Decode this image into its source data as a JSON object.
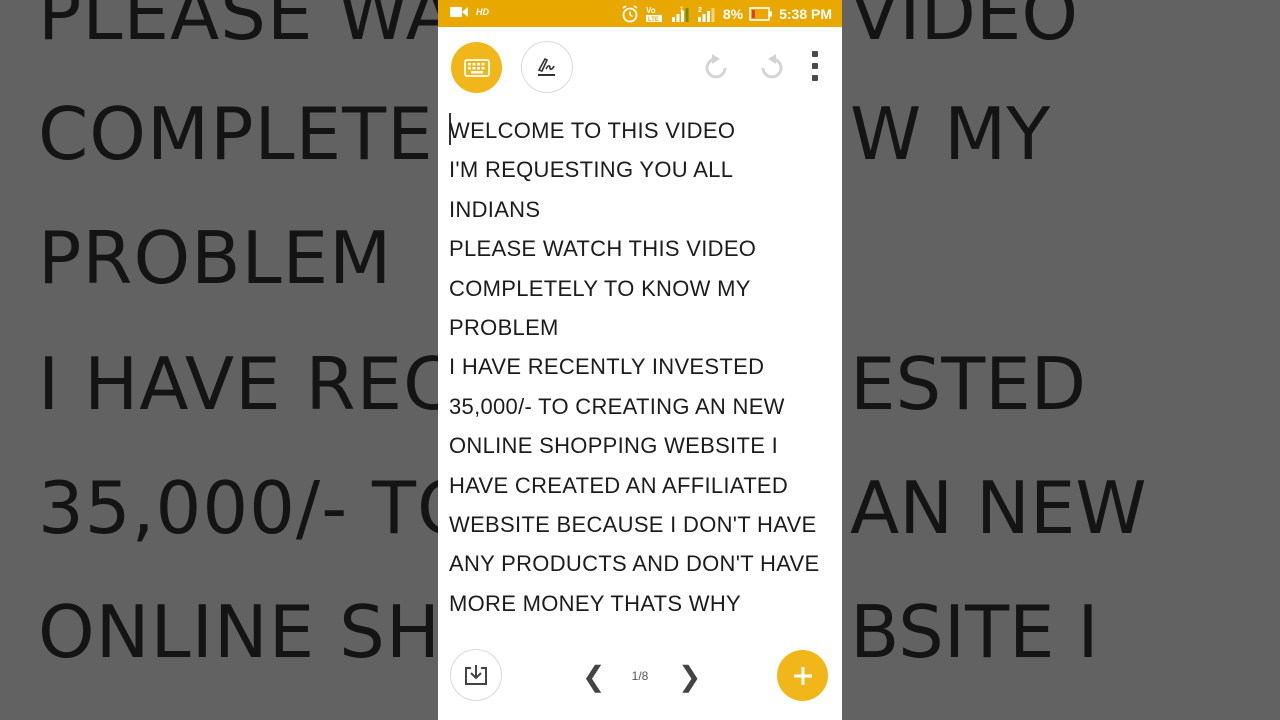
{
  "background": {
    "lines_left": [
      "PLEASE WA",
      "COMPLETE",
      "PROBLEM",
      "I HAVE REC",
      "35,000/- TO",
      "ONLINE SHO"
    ],
    "lines_right": [
      "VIDEO",
      "W MY",
      "ESTED",
      "AN NEW",
      "BSITE I"
    ]
  },
  "status_bar": {
    "hd": "HD",
    "battery_percent": "8%",
    "time": "5:38 PM",
    "sim1": "1",
    "sim2": "2",
    "volte": "VoLTE"
  },
  "toolbar": {
    "keyboard_icon": "keyboard-icon",
    "pen_icon": "handwriting-icon",
    "undo_icon": "undo-icon",
    "redo_icon": "redo-icon",
    "more_icon": "more-vertical-icon"
  },
  "note_lines": [
    "WELCOME TO THIS VIDEO",
    "I'M REQUESTING YOU ALL",
    "INDIANS",
    "PLEASE WATCH THIS VIDEO",
    "COMPLETELY TO KNOW MY",
    "PROBLEM",
    "I HAVE RECENTLY INVESTED",
    "35,000/- TO CREATING AN NEW",
    "ONLINE SHOPPING WEBSITE I",
    "HAVE CREATED AN AFFILIATED",
    "WEBSITE BECAUSE I DON'T HAVE",
    "ANY PRODUCTS AND DON'T HAVE",
    "MORE MONEY THATS WHY"
  ],
  "bottom_bar": {
    "prev": "❮",
    "page": "1/8",
    "next": "❯"
  },
  "colors": {
    "accent": "#f1b71a",
    "status_bar": "#e9a800"
  }
}
